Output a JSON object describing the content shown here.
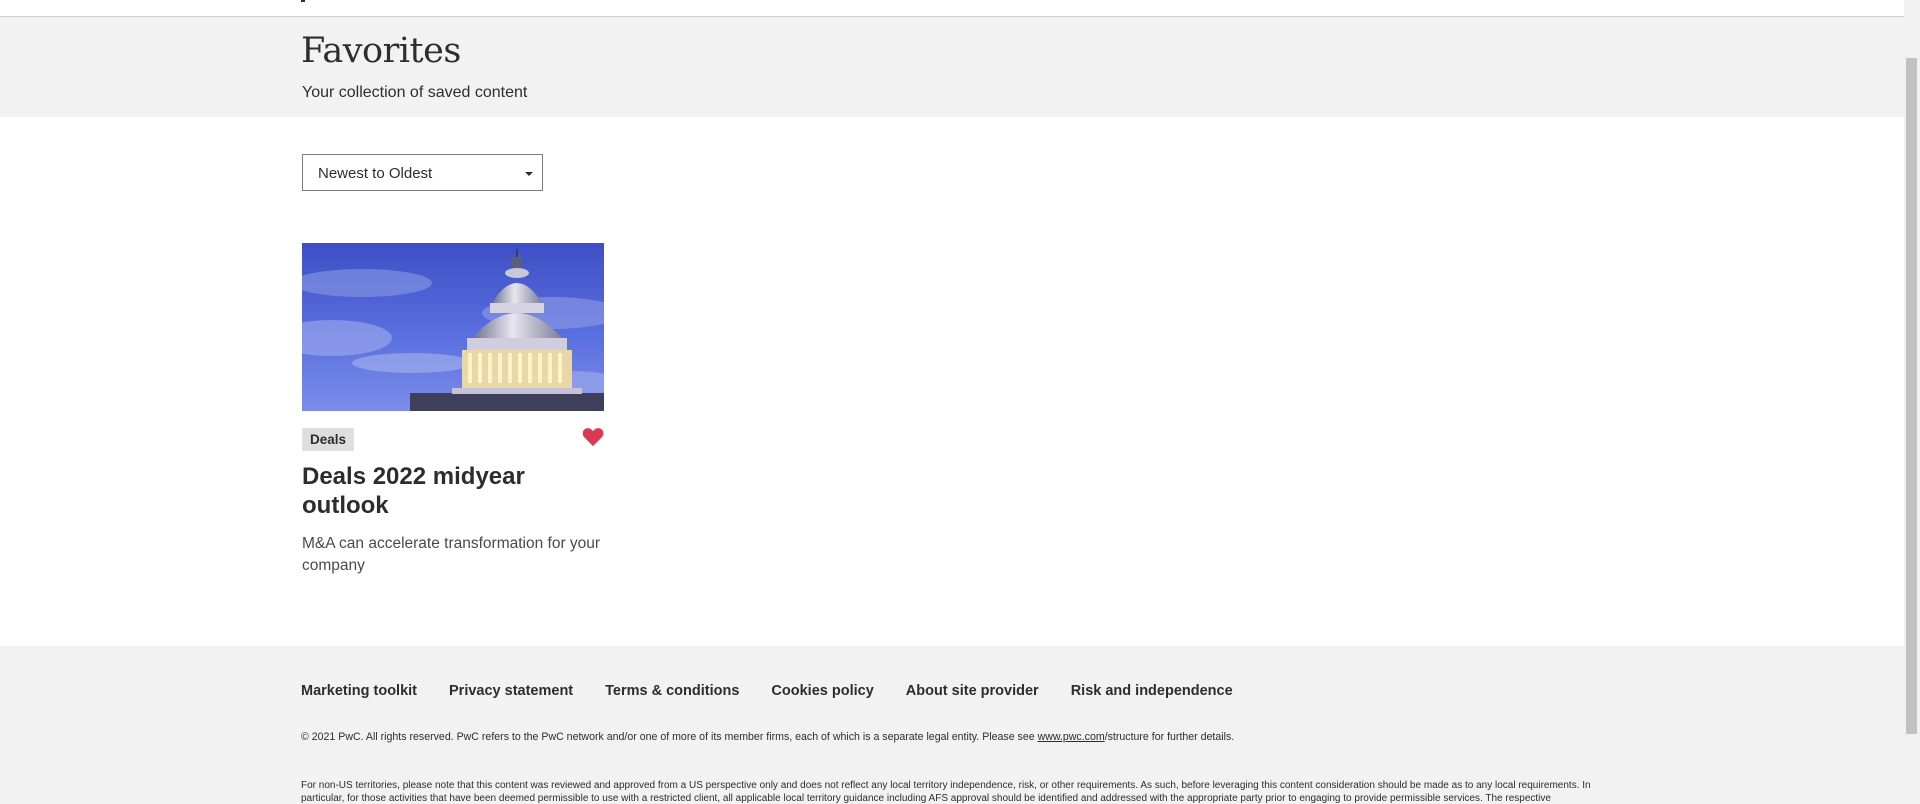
{
  "header": {
    "title": "Favorites",
    "subtitle": "Your collection of saved content"
  },
  "sort": {
    "selected": "Newest to Oldest"
  },
  "favorites": [
    {
      "tag": "Deals",
      "title": "Deals 2022 midyear outlook",
      "description": "M&A can accelerate transformation for your company",
      "image": "us-capitol-dome-at-dusk",
      "favorited": true,
      "heart_color": "#d93954"
    }
  ],
  "footer": {
    "links": [
      "Marketing toolkit",
      "Privacy statement",
      "Terms & conditions",
      "Cookies policy",
      "About site provider",
      "Risk and independence"
    ],
    "copyright_pre": "© 2021 PwC. All rights reserved. PwC refers to the PwC network and/or one of more of its member firms, each of which is a separate legal entity. Please see ",
    "copyright_link": "www.pwc.com",
    "copyright_post": "/structure for further details.",
    "disclaimer": "For non-US territories, please note that this content was reviewed and approved from a US perspective only and does not reflect any local territory independence, risk, or other requirements. As such, before leveraging this content consideration should be made as to any local requirements. In particular, for those activities that have been deemed permissible to use with a restricted client, all applicable local territory guidance including AFS approval should be identified and addressed with the appropriate party prior to engaging to provide permissible services. The respective"
  },
  "colors": {
    "hero_bg": "#f2f2f2",
    "text": "#2d2d2d",
    "accent_heart": "#d93954",
    "tag_bg": "#dedede"
  }
}
